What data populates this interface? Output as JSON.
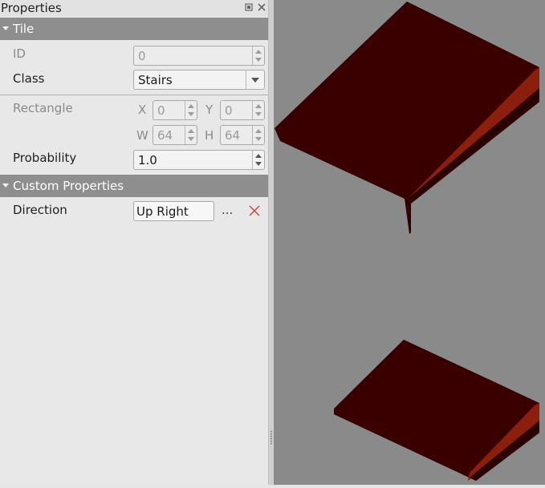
{
  "panel_title": "Properties",
  "tile_group": "Tile",
  "fields": {
    "id_label": "ID",
    "id_value": "0",
    "class_label": "Class",
    "class_value": "Stairs",
    "rect_label": "Rectangle",
    "x_label": "X",
    "x_value": "0",
    "y_label": "Y",
    "y_value": "0",
    "w_label": "W",
    "w_value": "64",
    "h_label": "H",
    "h_value": "64",
    "prob_label": "Probability",
    "prob_value": "1.0"
  },
  "custom_group": "Custom Properties",
  "custom": {
    "direction_label": "Direction",
    "direction_value": "Up Right",
    "more_button": "..."
  },
  "icons": [
    "float-icon",
    "close-icon",
    "chevron-down-icon",
    "remove-property-icon"
  ],
  "colors": {
    "group_header": "#8e8e8e",
    "canvas_bg": "#8a8a8a",
    "tile_dark": "#3a0000",
    "tile_red": "#8c1e0e",
    "remove_red": "#d04040"
  }
}
